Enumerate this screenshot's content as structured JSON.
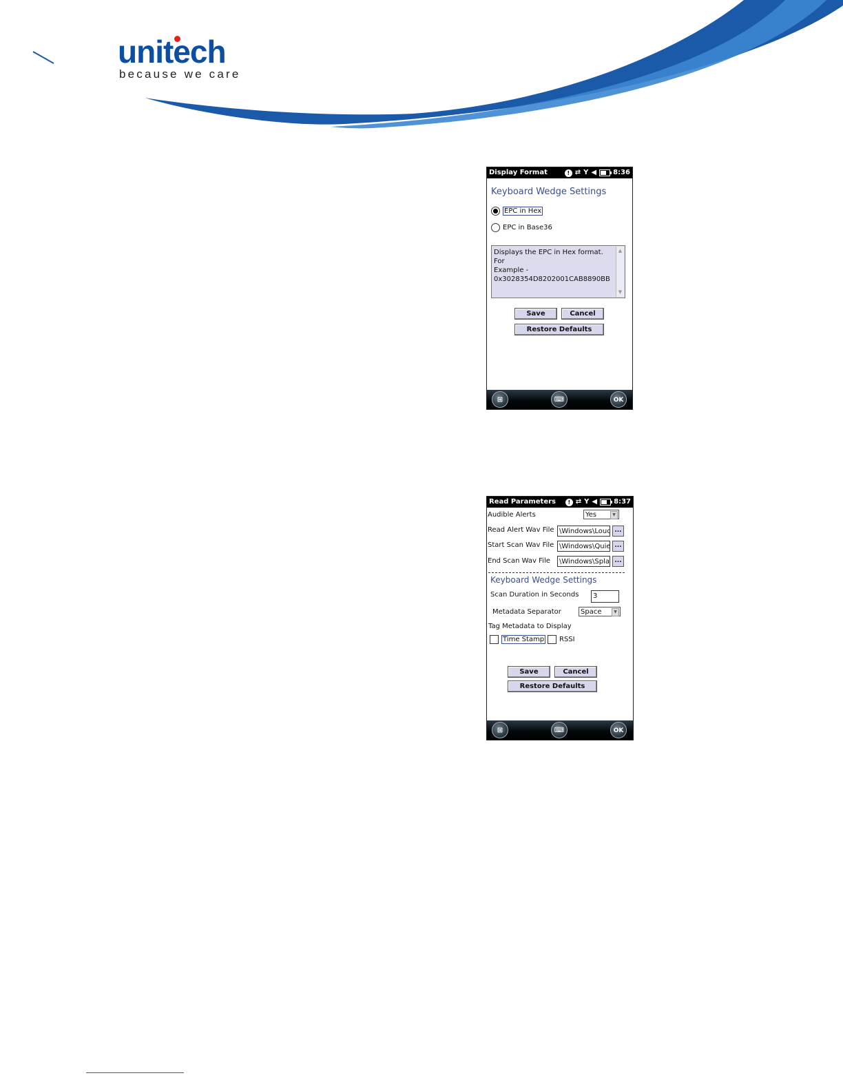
{
  "branding": {
    "logo_text": "unitech",
    "tagline": "because we care"
  },
  "display_format_screen": {
    "status_title": "Display Format",
    "time": "8:36",
    "section_title": "Keyboard Wedge Settings",
    "options": [
      {
        "label": "EPC in Hex",
        "selected": true
      },
      {
        "label": "EPC in Base36",
        "selected": false
      }
    ],
    "description_lines": [
      "Displays the EPC in Hex format. For",
      "Example -",
      "0x3028354D8202001CAB8890BB"
    ],
    "save_label": "Save",
    "cancel_label": "Cancel",
    "restore_label": "Restore Defaults",
    "ok_label": "OK"
  },
  "read_parameters_screen": {
    "status_title": "Read Parameters",
    "time": "8:37",
    "audible_alerts": {
      "label": "Audible Alerts",
      "value": "Yes"
    },
    "read_alert": {
      "label": "Read Alert Wav File",
      "value": "\\Windows\\Loud"
    },
    "start_scan": {
      "label": "Start Scan Wav File",
      "value": "\\Windows\\Quie"
    },
    "end_scan": {
      "label": "End Scan Wav File",
      "value": "\\Windows\\Spla"
    },
    "browse_label": "...",
    "section_title": "Keyboard Wedge Settings",
    "scan_duration": {
      "label": "Scan Duration in Seconds",
      "value": "3"
    },
    "metadata_separator": {
      "label": "Metadata Separator",
      "value": "Space"
    },
    "tag_metadata_label": "Tag Metadata to Display",
    "checkboxes": [
      {
        "label": "Time Stamp",
        "checked": false
      },
      {
        "label": "RSSI",
        "checked": false
      }
    ],
    "save_label": "Save",
    "cancel_label": "Cancel",
    "restore_label": "Restore Defaults",
    "ok_label": "OK"
  },
  "colors": {
    "brand_blue": "#0b4ea2",
    "section_title": "#3a4f8f",
    "button_fill": "#d6d6ec"
  }
}
